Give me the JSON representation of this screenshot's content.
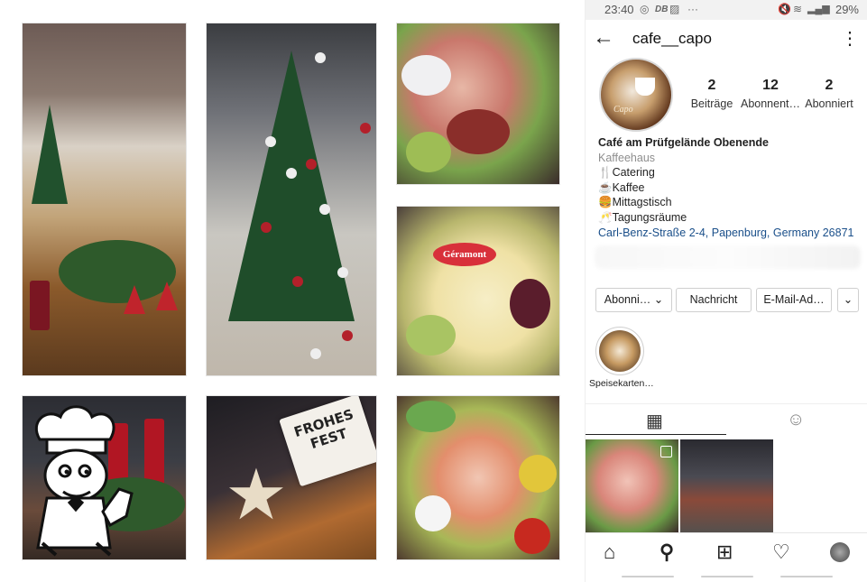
{
  "gallery": {
    "tiles": [
      {
        "subject": "cafe-interior"
      },
      {
        "subject": "christmas-tree"
      },
      {
        "subject": "meat-platter"
      },
      {
        "subject": "cheese-platter",
        "brand_text": "Géramont"
      },
      {
        "subject": "advent-candles"
      },
      {
        "subject": "frohes-fest-lightbox",
        "sign_text": "FROHES FEST"
      },
      {
        "subject": "fish-meat-platter"
      }
    ],
    "overlay_icon": "chef-thumbs-up-icon"
  },
  "statusbar": {
    "time": "23:40",
    "icons": [
      "instagram-icon",
      "db-icon",
      "image-icon",
      "ellipsis-icon"
    ],
    "right_icons": [
      "mute-icon",
      "wifi-icon",
      "signal-icon"
    ],
    "battery": "29%"
  },
  "profile": {
    "username": "cafe__capo",
    "avatar_text": "Capo",
    "stats": [
      {
        "value": "2",
        "label": "Beiträge"
      },
      {
        "value": "12",
        "label": "Abonnent…"
      },
      {
        "value": "2",
        "label": "Abonniert"
      }
    ],
    "bio": {
      "name": "Café am Prüfgelände Obenende",
      "category": "Kaffeehaus",
      "lines": [
        "🍴Catering",
        "☕Kaffee",
        "🍔Mittagstisch",
        "🥂Tagungsräume"
      ],
      "address": "Carl-Benz-Straße 2-4, Papenburg, Germany 26871"
    },
    "buttons": {
      "follow": "Abonni…",
      "message": "Nachricht",
      "email": "E-Mail-Ad…"
    },
    "highlight": {
      "label": "Speisekarten…"
    }
  },
  "nav": {
    "icons": [
      "home-icon",
      "search-icon",
      "add-icon",
      "heart-icon",
      "profile-icon"
    ]
  },
  "colors": {
    "link": "#1a4f8a",
    "category": "#8e8e8e"
  }
}
